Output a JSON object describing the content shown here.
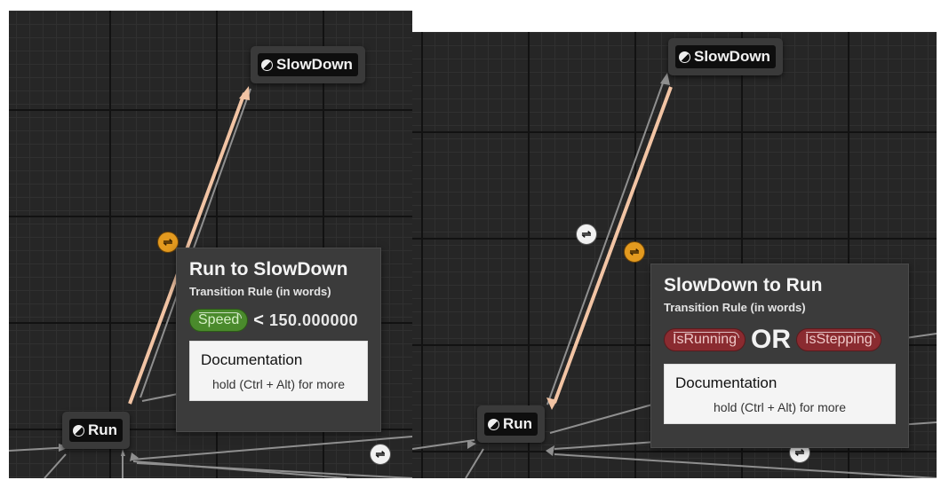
{
  "left": {
    "nodes": {
      "slowdown": "SlowDown",
      "run": "Run"
    },
    "tooltip": {
      "title": "Run to SlowDown",
      "subtitle": "Transition Rule (in words)",
      "variable": "Speed",
      "operator": "<",
      "value": "150.000000",
      "doc_title": "Documentation",
      "doc_hint": "hold (Ctrl + Alt) for more"
    }
  },
  "right": {
    "nodes": {
      "slowdown": "SlowDown",
      "run": "Run"
    },
    "tooltip": {
      "title": "SlowDown to Run",
      "subtitle": "Transition Rule (in words)",
      "var_a": "IsRunning",
      "operator": "OR",
      "var_b": "IsStepping",
      "doc_title": "Documentation",
      "doc_hint": "hold (Ctrl + Alt) for more"
    }
  },
  "icons": {
    "state": "half-circle-icon",
    "transition": "transition-arrows-icon"
  },
  "colors": {
    "highlighted_wire": "#f0c0a0",
    "wire": "#9a9a9a",
    "transition_highlight": "#e39a1f",
    "bool_pill": "#8a2b30",
    "float_pill": "#4a8a2c"
  }
}
